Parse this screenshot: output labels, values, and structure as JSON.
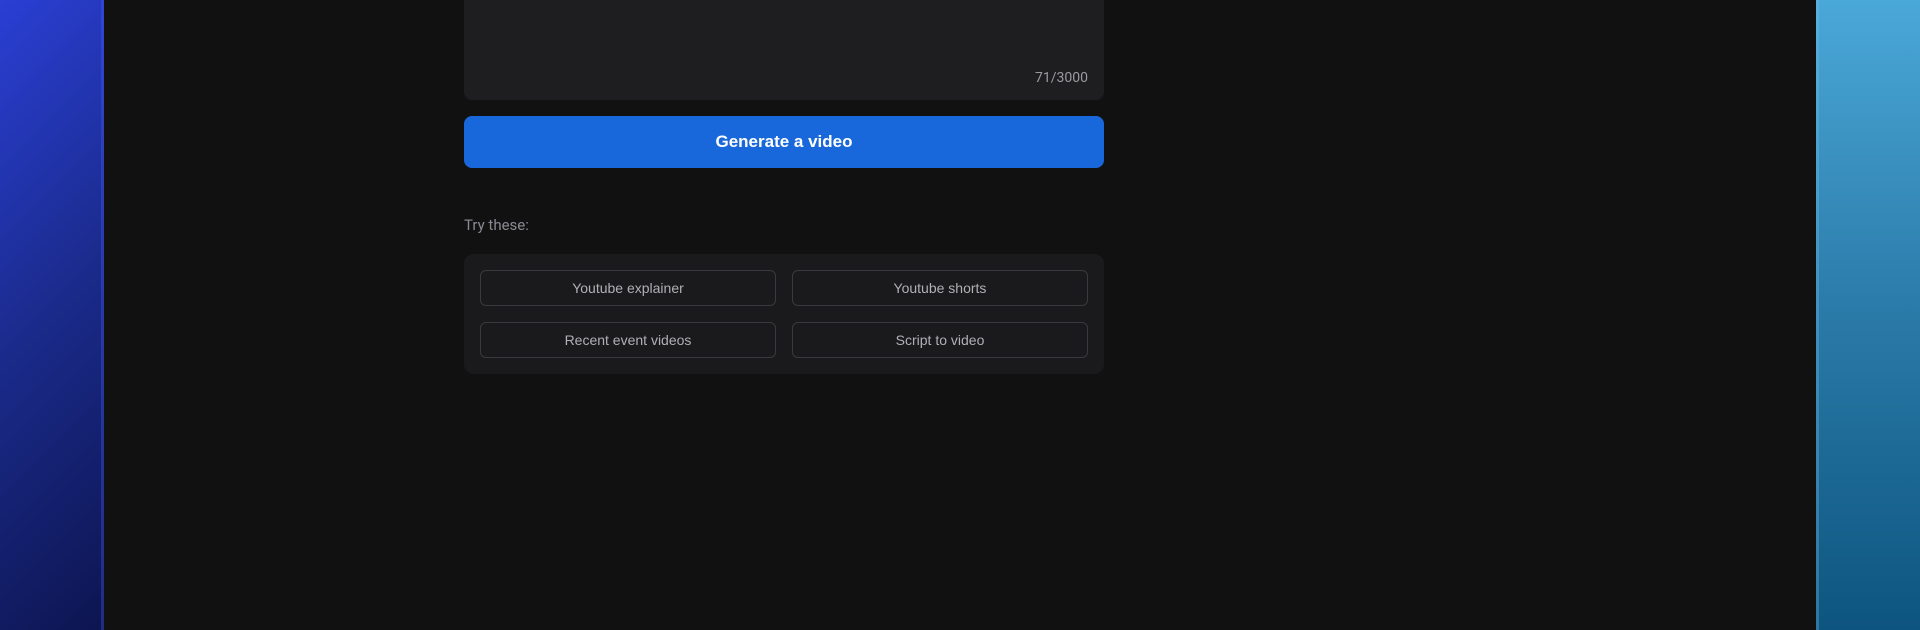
{
  "input": {
    "counter": "71/3000"
  },
  "primary_action": {
    "label": "Generate a video"
  },
  "suggestions": {
    "heading": "Try these:",
    "items": [
      {
        "label": "Youtube explainer"
      },
      {
        "label": "Youtube shorts"
      },
      {
        "label": "Recent event videos"
      },
      {
        "label": "Script to video"
      }
    ]
  }
}
